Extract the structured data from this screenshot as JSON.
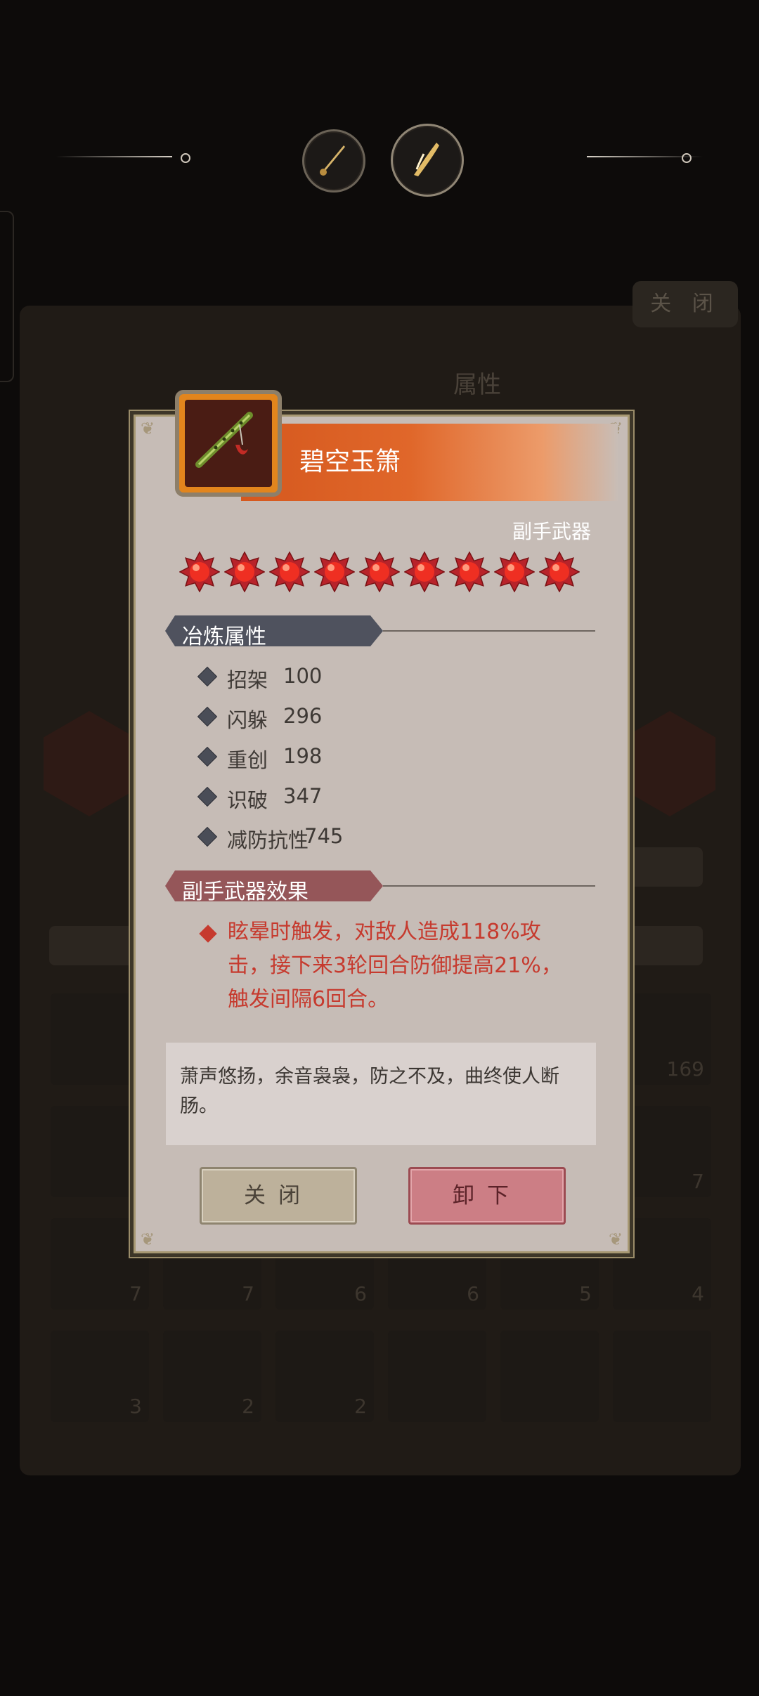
{
  "background": {
    "close_label": "关 闭",
    "attr_tab_label": "属性",
    "grid_counts": [
      "169",
      "7",
      "7",
      "7",
      "6",
      "6",
      "5",
      "4",
      "3",
      "2",
      "2"
    ]
  },
  "item": {
    "name": "碧空玉箫",
    "type": "副手武器",
    "star_count": 9,
    "refine_section_title": "冶炼属性",
    "attributes": [
      {
        "name": "招架",
        "value": "100"
      },
      {
        "name": "闪躲",
        "value": "296"
      },
      {
        "name": "重创",
        "value": "198"
      },
      {
        "name": "识破",
        "value": "347"
      },
      {
        "name": "减防抗性",
        "value": "745"
      }
    ],
    "effect_section_title": "副手武器效果",
    "effect_lines": [
      "眩晕时触发，对敌人造成118%攻",
      "击，接下来3轮回合防御提高21%，",
      "触发间隔6回合。"
    ],
    "flavor_text": "萧声悠扬，余音袅袅，防之不及，曲终使人断肠。"
  },
  "buttons": {
    "close": "关闭",
    "unequip": "卸下"
  },
  "colors": {
    "header_orange": "#d5581e",
    "effect_red": "#c63a2e",
    "refine_tag": "#4f525e",
    "effect_tag": "#955659"
  }
}
